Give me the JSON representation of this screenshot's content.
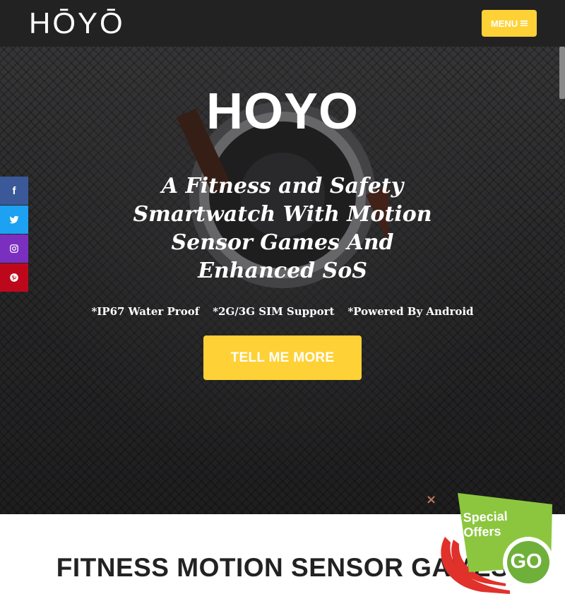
{
  "header": {
    "logo": "HŌYŌ",
    "menu_label": "MENU"
  },
  "hero": {
    "title": "HOYO",
    "subtitle": "A Fitness and Safety Smartwatch With Motion Sensor Games And Enhanced SoS",
    "features": [
      "*IP67 Water Proof",
      "*2G/3G SIM Support",
      "*Powered By Android"
    ],
    "cta_label": "TELL ME MORE"
  },
  "social": {
    "items": [
      {
        "icon": "facebook-icon",
        "glyph": "f"
      },
      {
        "icon": "twitter-icon",
        "glyph": ""
      },
      {
        "icon": "instagram-icon",
        "glyph": ""
      },
      {
        "icon": "pinterest-icon",
        "glyph": ""
      }
    ]
  },
  "section": {
    "title": "FITNESS MOTION SENSOR GAMES"
  },
  "offer": {
    "label": "Special Offers",
    "go": "GO",
    "close": "×"
  },
  "colors": {
    "header_bg": "#222222",
    "accent_yellow": "#fed136",
    "offer_green": "#8cc63f",
    "offer_ring_red": "#e0312b"
  }
}
